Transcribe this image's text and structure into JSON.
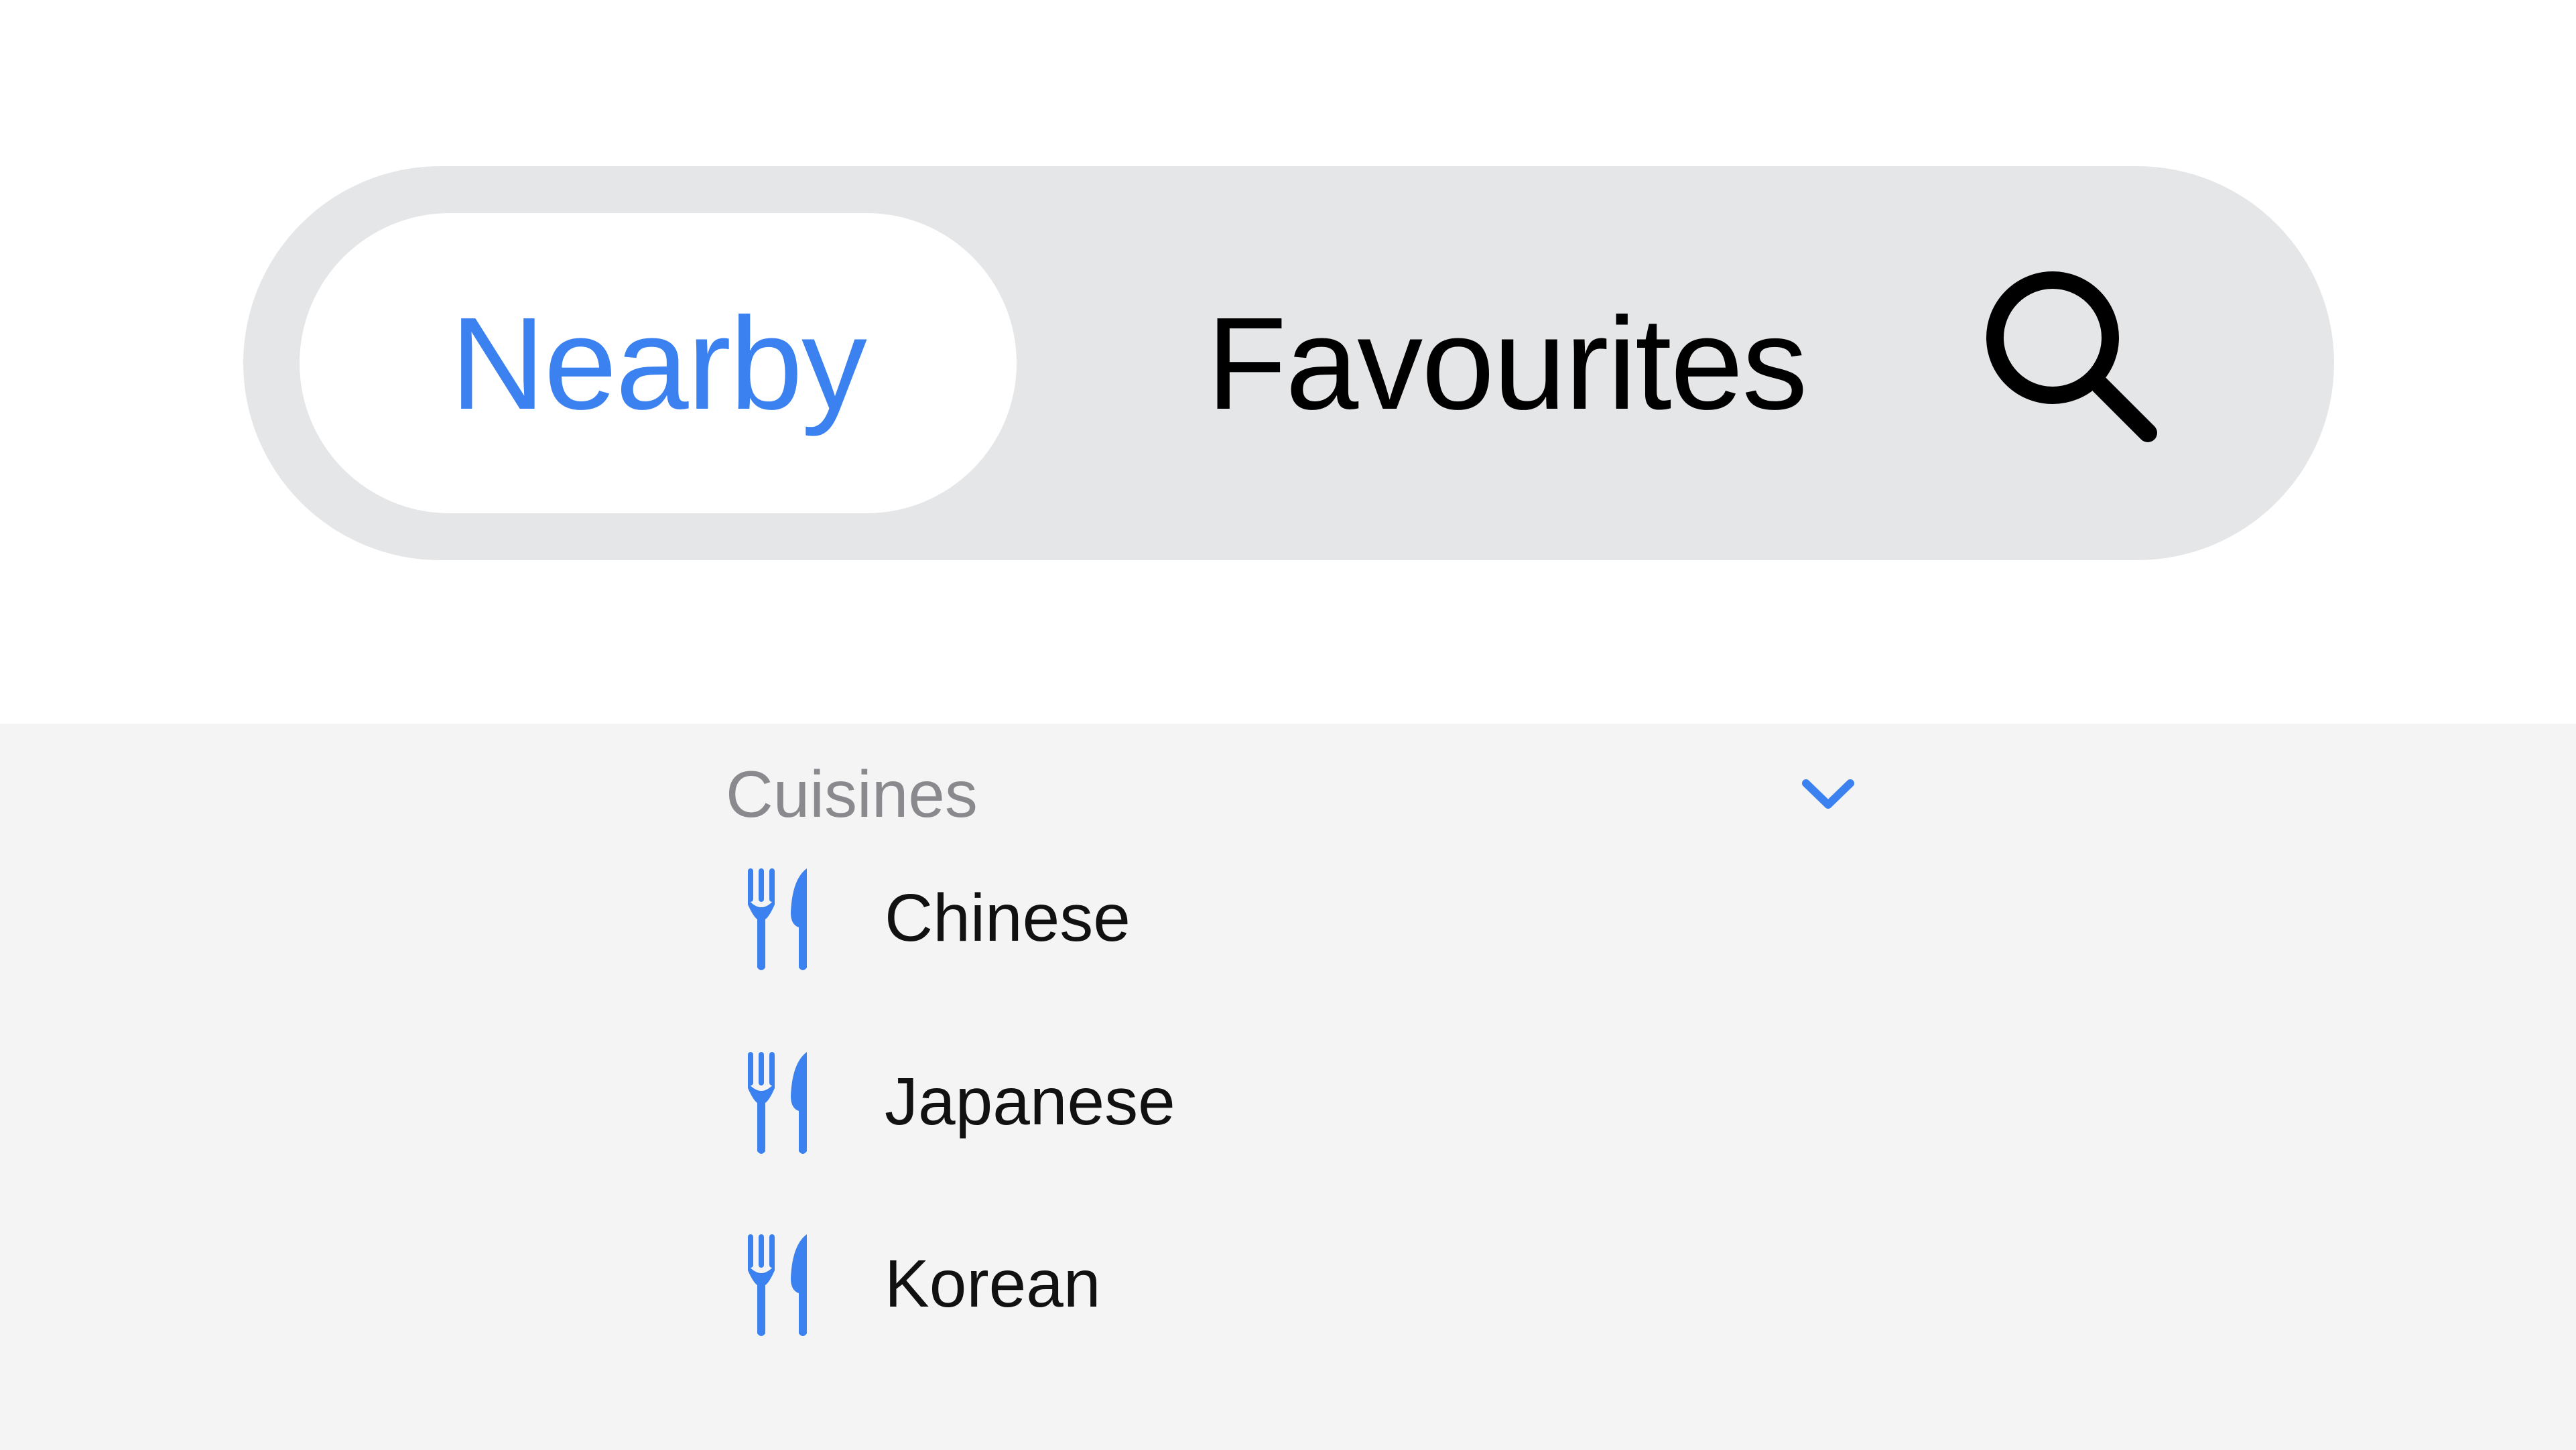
{
  "colors": {
    "accent": "#3b82f0",
    "control_background": "#e5e6e8",
    "panel_background": "#f4f4f4",
    "muted_text": "#8a8a8e"
  },
  "segmented_control": {
    "tabs": [
      {
        "label": "Nearby",
        "selected": true
      },
      {
        "label": "Favourites",
        "selected": false
      }
    ],
    "search_icon": "search-icon"
  },
  "cuisines": {
    "title": "Cuisines",
    "toggle_icon": "chevron-down-icon",
    "items": [
      {
        "label": "Chinese",
        "icon": "fork-knife-icon"
      },
      {
        "label": "Japanese",
        "icon": "fork-knife-icon"
      },
      {
        "label": "Korean",
        "icon": "fork-knife-icon"
      }
    ]
  }
}
